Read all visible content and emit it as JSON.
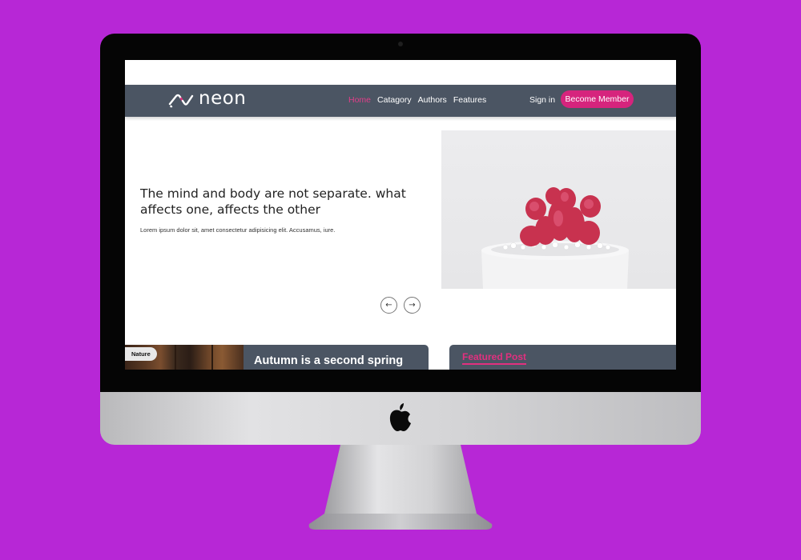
{
  "brand": {
    "name": "neon",
    "accent_color": "#d6247d",
    "nav_color": "#4b5563",
    "background_color": "#b727d6"
  },
  "nav": {
    "links": [
      {
        "label": "Home",
        "active": true
      },
      {
        "label": "Catagory",
        "active": false
      },
      {
        "label": "Authors",
        "active": false
      },
      {
        "label": "Features",
        "active": false
      }
    ],
    "signin_label": "Sign in",
    "cta_label": "Become Member"
  },
  "hero": {
    "title": "The mind and body are not separate. what affects one, affects the other",
    "subtitle": "Lorem ipsum dolor sit, amet consectetur adipisicing elit. Accusamus, iure.",
    "image_icon": "cactus-pot-image",
    "prev_icon": "arrow-left-icon",
    "next_icon": "arrow-right-icon"
  },
  "cards": {
    "left": {
      "badge": "Nature",
      "title": "Autumn is a second spring"
    },
    "right": {
      "label": "Featured Post"
    }
  },
  "device": {
    "logo_icon": "apple-logo-icon"
  }
}
